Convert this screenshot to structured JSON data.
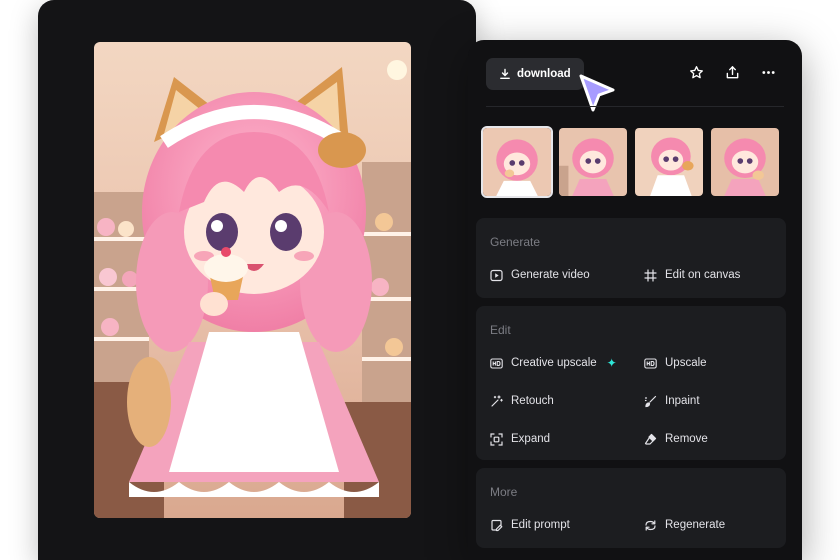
{
  "toolbar": {
    "download_label": "download",
    "icons": [
      "download-icon",
      "star-icon",
      "share-icon",
      "more-icon"
    ]
  },
  "thumbnails": {
    "count": 4,
    "selected_index": 0
  },
  "sections": {
    "generate": {
      "title": "Generate",
      "generate_video": "Generate video",
      "edit_on_canvas": "Edit on canvas"
    },
    "edit": {
      "title": "Edit",
      "creative_upscale": "Creative upscale",
      "upscale": "Upscale",
      "retouch": "Retouch",
      "inpaint": "Inpaint",
      "expand": "Expand",
      "remove": "Remove"
    },
    "more": {
      "title": "More",
      "edit_prompt": "Edit prompt",
      "regenerate": "Regenerate"
    }
  },
  "colors": {
    "panel_bg": "#111113",
    "section_bg": "#1c1d20",
    "button_bg": "#2b2c30",
    "cursor_accent": "#a79cff",
    "sparkle_accent": "#2ee6d8"
  }
}
